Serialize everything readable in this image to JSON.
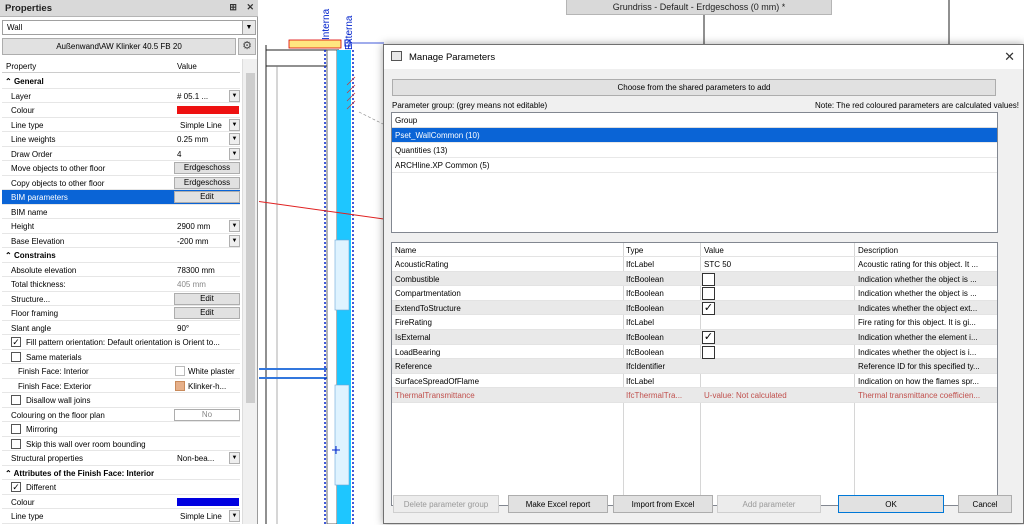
{
  "properties": {
    "title": "Properties",
    "selector_value": "Wall",
    "wall_type": "Außenwand\\AW Klinker 40.5 FB 20",
    "col_property": "Property",
    "col_value": "Value",
    "rows": {
      "general": "General",
      "layer": "Layer",
      "layer_val": "# 05.1 ...",
      "colour": "Colour",
      "line_type": "Line type",
      "line_type_val": "Simple Line",
      "line_weights": "Line weights",
      "line_weights_val": "0.25 mm",
      "draw_order": "Draw Order",
      "draw_order_val": "4",
      "move_objects": "Move objects to other floor",
      "move_objects_btn": "Erdgeschoss",
      "copy_objects": "Copy objects to other floor",
      "copy_objects_btn": "Erdgeschoss",
      "bim_parameters": "BIM parameters",
      "bim_parameters_btn": "Edit",
      "bim_name": "BIM name",
      "height": "Height",
      "height_val": "2900 mm",
      "base_elevation": "Base Elevation",
      "base_elevation_val": "-200 mm",
      "constrains": "Constrains",
      "absolute_elevation": "Absolute elevation",
      "absolute_elevation_val": "78300 mm",
      "total_thickness": "Total thickness:",
      "total_thickness_val": "405 mm",
      "structure": "Structure...",
      "structure_btn": "Edit",
      "floor_framing": "Floor framing",
      "floor_framing_btn": "Edit",
      "slant_angle": "Slant angle",
      "slant_angle_val": "90°",
      "fill_pattern": "Fill pattern orientation: Default orientation is Orient to...",
      "same_materials": "Same materials",
      "finish_interior": "Finish Face: Interior",
      "finish_interior_val": "White plaster",
      "finish_exterior": "Finish Face: Exterior",
      "finish_exterior_val": "Klinker-h...",
      "disallow_joins": "Disallow wall joins",
      "colouring_floor_plan": "Colouring on the floor plan",
      "colouring_val": "No",
      "mirroring": "Mirroring",
      "skip_wall": "Skip this wall over room bounding",
      "structural_properties": "Structural properties",
      "structural_val": "Non-bea...",
      "attr_finish_interior": "Attributes of the Finish Face: Interior",
      "different": "Different",
      "colour2": "Colour",
      "line_type2": "Line type",
      "line_type2_val": "Simple Line"
    },
    "colours": {
      "colour": "#ee1111",
      "colour2": "#0000e0"
    }
  },
  "drawing": {
    "title": "Grundriss - Default - Erdgeschoss (0 mm) *",
    "label_interna": "Interna",
    "label_externa": "Externa"
  },
  "dialog": {
    "title": "Manage Parameters",
    "shared_button": "Choose from the shared parameters to add",
    "param_group_label": "Parameter group: (grey means not editable)",
    "note": "Note: The red coloured parameters are calculated values!",
    "group_header": "Group",
    "groups": [
      "Pset_WallCommon (10)",
      "Quantities (13)",
      "ARCHline.XP Common (5)"
    ],
    "columns": [
      "Name",
      "Type",
      "Value",
      "Description"
    ],
    "params": [
      {
        "name": "AcousticRating",
        "type": "IfcLabel",
        "value": "STC 50",
        "desc": "Acoustic rating for this object. It ..."
      },
      {
        "name": "Combustible",
        "type": "IfcBoolean",
        "value": "",
        "desc": "Indication whether the object is ..."
      },
      {
        "name": "Compartmentation",
        "type": "IfcBoolean",
        "value": "",
        "desc": "Indication whether the object is ..."
      },
      {
        "name": "ExtendToStructure",
        "type": "IfcBoolean",
        "value": "",
        "desc": "Indicates whether the object ext..."
      },
      {
        "name": "FireRating",
        "type": "IfcLabel",
        "value": "",
        "desc": "Fire rating for this object. It is gi..."
      },
      {
        "name": "IsExternal",
        "type": "IfcBoolean",
        "value": "",
        "desc": "Indication whether the element i..."
      },
      {
        "name": "LoadBearing",
        "type": "IfcBoolean",
        "value": "",
        "desc": "Indicates whether the object is i..."
      },
      {
        "name": "Reference",
        "type": "IfcIdentifier",
        "value": "",
        "desc": "Reference ID for this specified ty..."
      },
      {
        "name": "SurfaceSpreadOfFlame",
        "type": "IfcLabel",
        "value": "",
        "desc": "Indication on how the flames spr..."
      },
      {
        "name": "ThermalTransmittance",
        "type": "IfcThermalTra...",
        "value": "U-value: Not calculated",
        "desc": "Thermal transmittance coefficien..."
      }
    ],
    "buttons": {
      "delete_group": "Delete parameter group",
      "excel_report": "Make Excel report",
      "import_excel": "Import from Excel",
      "add_parameter": "Add parameter",
      "ok": "OK",
      "cancel": "Cancel"
    }
  }
}
